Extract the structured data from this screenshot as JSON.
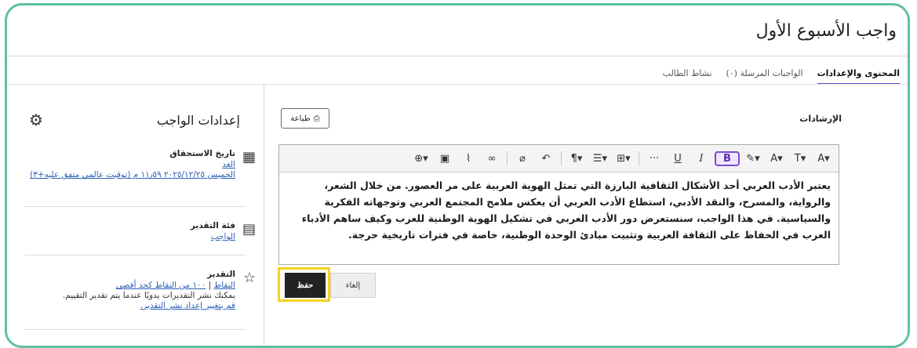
{
  "page": {
    "title": "واجب الأسبوع الأول"
  },
  "tabs": [
    {
      "label": "المحتوى والإعدادات",
      "active": true
    },
    {
      "label": "الواجبات المرسلة (٠)",
      "active": false
    },
    {
      "label": "نشاط الطالب",
      "active": false
    }
  ],
  "instructions": {
    "label": "الإرشادات",
    "print_label": "طباعة",
    "content": "يعتبر الأدب العربي أحد الأشكال الثقافية البارزة التي تمثل الهوية العربية على مر العصور. من خلال الشعر، والرواية، والمسرح، والنقد الأدبي، استطاع الأدب العربي أن يعكس ملامح المجتمع العربي وتوجهاته الفكرية والسياسية. في هذا الواجب، سنستعرض دور الأدب العربي في تشكيل الهوية الوطنية للعرب وكيف ساهم الأدباء العرب في الحفاظ على الثقافة العربية وتثبيت مبادئ الوحدة الوطنية، خاصة في فترات تاريخية حرجة."
  },
  "toolbar": [
    {
      "name": "text-style-button",
      "glyph": "A̸▾"
    },
    {
      "name": "font-size-button",
      "glyph": "T̶▾"
    },
    {
      "name": "font-color-button",
      "glyph": "A̸▾"
    },
    {
      "name": "highlight-button",
      "glyph": "✎▾"
    },
    {
      "name": "bold-button",
      "glyph": "B"
    },
    {
      "name": "italic-button",
      "glyph": "I"
    },
    {
      "name": "underline-button",
      "glyph": "U"
    },
    {
      "name": "more-button",
      "glyph": "···"
    },
    {
      "name": "table-button",
      "glyph": "⊞▾"
    },
    {
      "name": "align-button",
      "glyph": "☰▾"
    },
    {
      "name": "paragraph-button",
      "glyph": "¶▾"
    },
    {
      "name": "undo-button",
      "glyph": "⊂"
    },
    {
      "name": "clear-format-button",
      "glyph": "⌀"
    },
    {
      "name": "link-button",
      "glyph": "∞"
    },
    {
      "name": "attach-button",
      "glyph": "⊘"
    },
    {
      "name": "image-button",
      "glyph": "▣"
    },
    {
      "name": "insert-button",
      "glyph": "⊕▾"
    }
  ],
  "actions": {
    "save_label": "حفظ",
    "cancel_label": "إلغاء"
  },
  "settings": {
    "title": "إعدادات الواجب",
    "due_date": {
      "label": "تاريخ الاستحقاق",
      "link1": "الغد",
      "link2": "الخميس ٢٠٢٥/١٢/٢٥ ١١٫٥٩ م (توقيت عالمي متفق عليه+٣)"
    },
    "grade_category": {
      "label": "فئة التقدير",
      "link": "الواجب"
    },
    "grading": {
      "label": "التقدير",
      "link1": "النقاط",
      "separator": "|",
      "link2": "١٠٠ من النقاط كحد أقصى",
      "note": "يمكنك نشر التقديرات يدويًا عندما يتم تقدير التقييم.",
      "link3": "قم بتغيير إعداد نشر التقدير."
    }
  },
  "colors": {
    "accent": "#5fc0a6",
    "highlight": "#f3d21f",
    "bold_accent": "#7b4cd0",
    "link": "#2b5fb3"
  }
}
